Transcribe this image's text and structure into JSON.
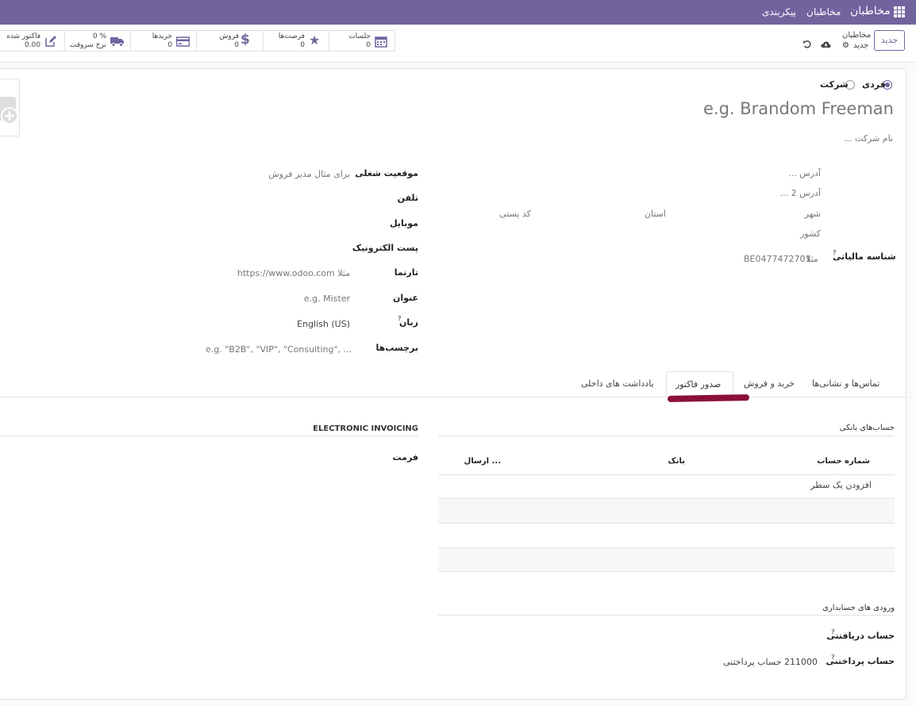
{
  "navbar": {
    "app_name": "مخاطبان",
    "menu_contacts": "مخاطبان",
    "menu_config": "پیکربندی"
  },
  "control": {
    "new_button": "جدید",
    "breadcrumb_parent": "مخاطبان",
    "breadcrumb_current": "جدید",
    "stats": [
      {
        "label": "جلسات",
        "value": "0",
        "icon": "calendar-icon"
      },
      {
        "label": "فرصت‌ها",
        "value": "0",
        "icon": "star-icon"
      },
      {
        "label": "فروش",
        "value": "0",
        "icon": "dollar-icon"
      },
      {
        "label": "خریدها",
        "value": "0",
        "icon": "credit-card-icon"
      },
      {
        "label": "0 %",
        "value": "نرخ سروقت",
        "icon": "truck-icon"
      },
      {
        "label": "فاکتور شده",
        "value": "0.00",
        "icon": "pencil-square-icon"
      }
    ]
  },
  "form": {
    "type_individual": "فردی",
    "type_company": "شرکت",
    "name_placeholder": "e.g. Brandom Freeman",
    "company_placeholder": "نام شرکت ...",
    "address": {
      "street": "آدرس ...",
      "street2": "آدرس 2 ...",
      "city": "شهر",
      "state": "استان",
      "zip": "کد پستی",
      "country": "کشور"
    },
    "vat_label": "شناسه مالیاتی",
    "vat_help": "?",
    "vat_prefix": "مثلا",
    "vat_placeholder": "BE0477472701",
    "right_fields": {
      "job_label": "موقعیت شغلی",
      "job_placeholder": "برای مثال مدیر فروش",
      "phone_label": "تلفن",
      "mobile_label": "موبایل",
      "email_label": "پست الکترونیک",
      "website_label": "تارنما",
      "website_placeholder": "مثلا https://www.odoo.com",
      "title_label": "عنوان",
      "title_placeholder": "e.g. Mister",
      "lang_label": "زبان",
      "lang_help": "?",
      "lang_value": "English (US)",
      "tags_label": "برچسب‌ها",
      "tags_placeholder": "e.g. \"B2B\", \"VIP\", \"Consulting\", ..."
    }
  },
  "tabs": {
    "contacts": "تماس‌ها و نشانی‌ها",
    "sales_purchase": "خرید و فروش",
    "invoicing": "صدور فاکتور",
    "internal_notes": "یادداشت های داخلی"
  },
  "invoicing": {
    "bank_section": "حساب‌های بانکی",
    "col_account": "شماره حساب",
    "col_bank": "بانک",
    "col_send": "ارسال ...",
    "add_line": "افزودن یک سطر",
    "einvoice_section": "ELECTRONIC INVOICING",
    "format_label": "فرمت",
    "accounting_section": "ورودی های حسابداری",
    "receivable_label": "حساب دریافتنی",
    "receivable_help": "?",
    "payable_label": "حساب پرداختنی",
    "payable_help": "?",
    "payable_value": "211000 حساب پرداختنی"
  },
  "colors": {
    "brand": "#71639e",
    "annotation": "#8b1038"
  }
}
